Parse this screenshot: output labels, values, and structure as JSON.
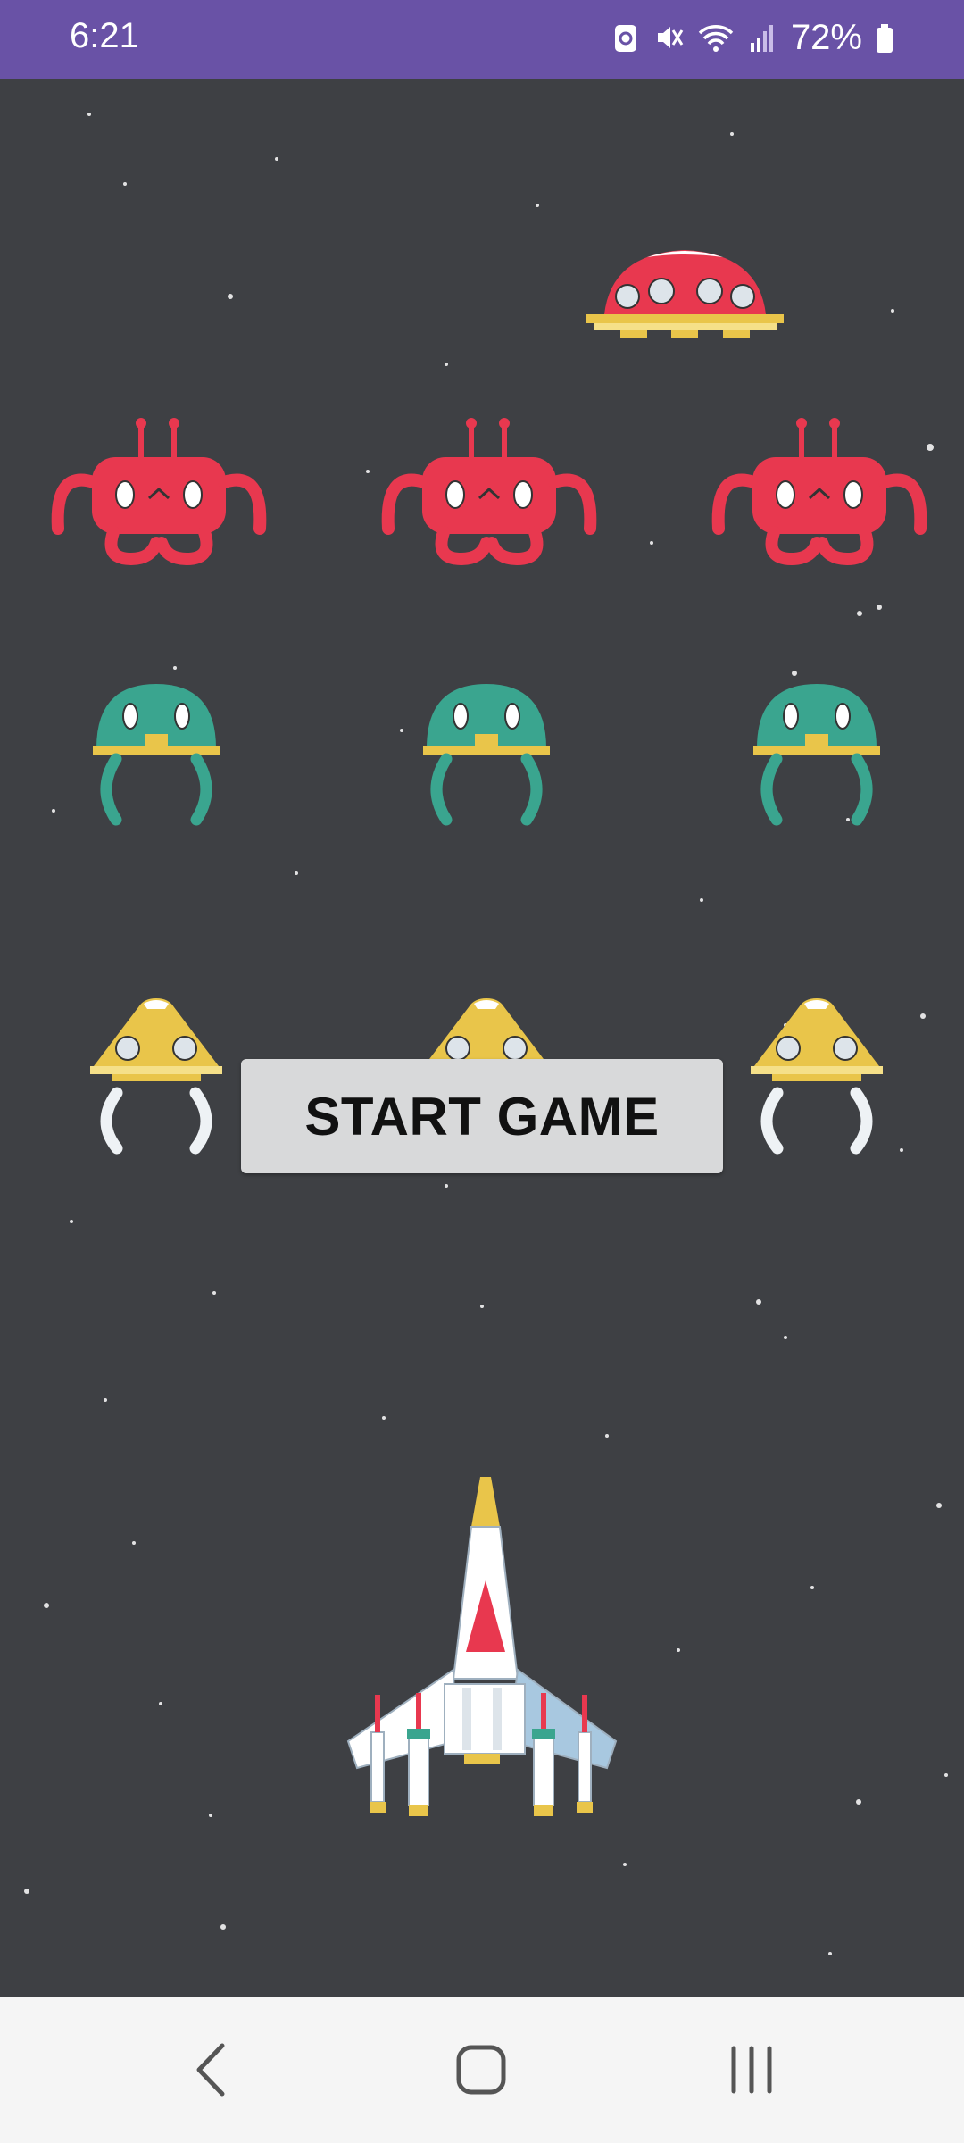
{
  "status_bar": {
    "time": "6:21",
    "battery": "72%",
    "icons": [
      "screenshot-icon",
      "mute-icon",
      "wifi-icon",
      "signal-icon",
      "battery-icon"
    ],
    "background": "#6952a6"
  },
  "game": {
    "background": "#3e4044",
    "start_button_label": "START GAME",
    "enemies": {
      "ufo": {
        "color": "#e8384f"
      },
      "crab_row": {
        "count": 3,
        "color": "#e8384f"
      },
      "helmet_row": {
        "count": 3,
        "color": "#3aa58f"
      },
      "pod_row": {
        "count": 3,
        "color": "#e9c54a"
      }
    },
    "player_ship": {
      "colors": [
        "#ffffff",
        "#e8384f",
        "#e9c54a",
        "#a8c8e0"
      ]
    }
  },
  "nav_bar": {
    "icons": [
      "back-icon",
      "home-icon",
      "recents-icon"
    ]
  }
}
